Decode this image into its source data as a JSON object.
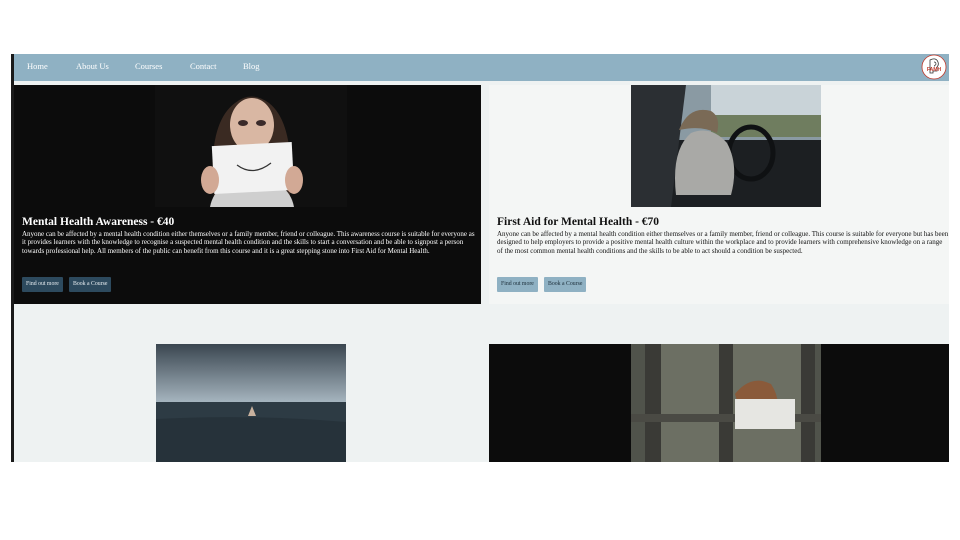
{
  "nav": {
    "items": [
      "Home",
      "About Us",
      "Courses",
      "Contact",
      "Blog"
    ],
    "logo_text": "FAMH",
    "logo_icon": "head-silhouette-icon"
  },
  "courses": [
    {
      "title": "Mental Health Awareness - €40",
      "description": "Anyone can be affected by a mental health condition either themselves or a family member, friend or colleague. This awareness course is suitable for everyone as it provides learners with the knowledge to recognise a suspected mental health condition and the skills to start a conversation and be able to signpost a person towards professional help. All members of the public can benefit from this course and it is a great stepping stone into First Aid for Mental Health.",
      "find_out_more": "Find out more",
      "book": "Book a Course",
      "image": "woman-holding-smiley-paper-photo"
    },
    {
      "title": "First Aid for Mental Health - €70",
      "description": "Anyone can be affected by a mental health condition either themselves or a family member, friend or colleague. This course is suitable for everyone but has been designed to help employers to provide a positive mental health culture within the workplace and to provide learners with comprehensive knowledge on a range of the most common mental health conditions and the skills to be able to act should a condition be suspected.",
      "find_out_more": "Find out more",
      "book": "Book a Course",
      "image": "person-resting-on-steering-wheel-photo"
    },
    {
      "image": "hand-reaching-out-of-sea-photo"
    },
    {
      "image": "person-leaning-on-window-frame-photo"
    }
  ],
  "colors": {
    "nav": "#8fb1c3",
    "dark_card": "#0c0c0c",
    "page_bg": "#eef2f2",
    "dark_button": "#2d4a5e",
    "light_button": "#8fb1c3",
    "logo_accent": "#c0392b"
  }
}
